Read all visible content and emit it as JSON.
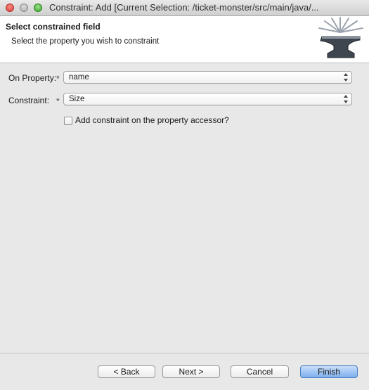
{
  "window": {
    "title": "Constraint: Add [Current Selection: /ticket-monster/src/main/java/..."
  },
  "banner": {
    "title": "Select constrained field",
    "description": "Select the property you wish to constraint",
    "icon": "anvil-icon"
  },
  "form": {
    "property_label": "On Property:",
    "property_required": "*",
    "property_value": "name",
    "constraint_label": "Constraint:",
    "constraint_required": "*",
    "constraint_value": "Size",
    "accessor_checkbox_label": "Add constraint on the property accessor?",
    "accessor_checked": false
  },
  "buttons": {
    "back": "< Back",
    "next": "Next >",
    "cancel": "Cancel",
    "finish": "Finish"
  },
  "colors": {
    "default_button": "#7fb0ee",
    "close_light": "#d9423a",
    "zoom_light": "#3aa52b"
  }
}
